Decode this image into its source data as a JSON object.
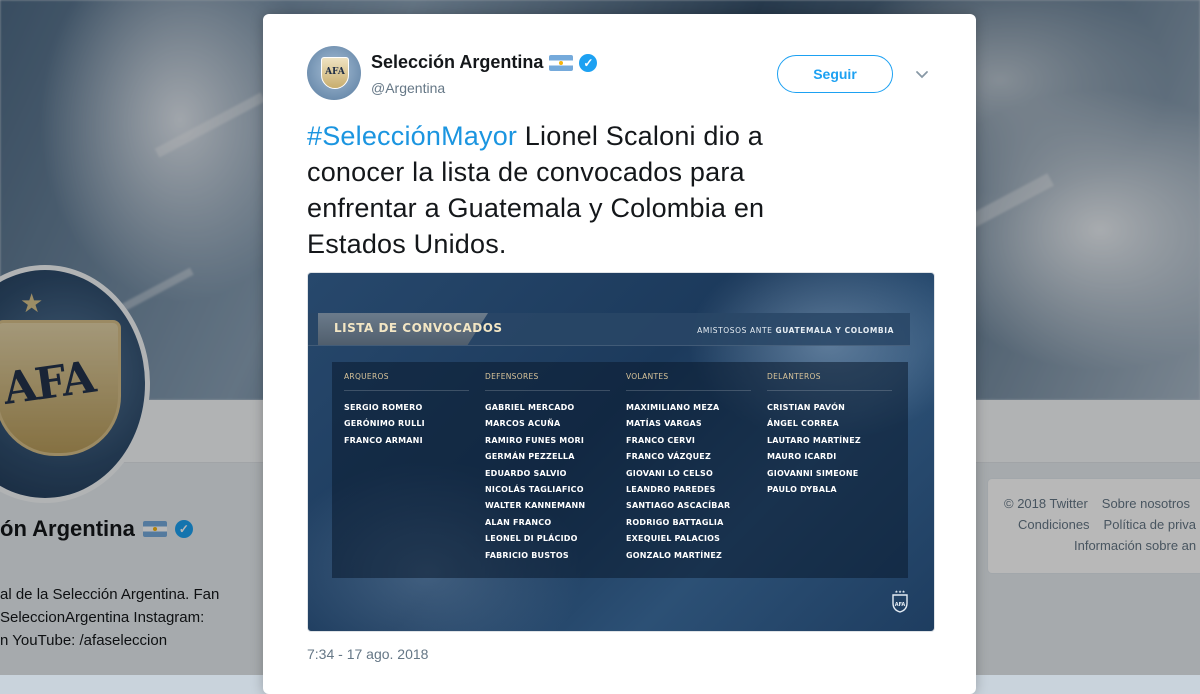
{
  "profile": {
    "name": "ón Argentina",
    "bio_lines": [
      "al de la Selección Argentina. Fan",
      "SeleccionArgentina Instagram:",
      "n YouTube: /afaseleccion"
    ],
    "footer_row1": [
      "© 2018 Twitter",
      "Sobre nosotros"
    ],
    "footer_row2": [
      "Condiciones",
      "Política de priva"
    ],
    "footer_row3": [
      "Información sobre an"
    ]
  },
  "tweet": {
    "author_name": "Selección Argentina",
    "author_handle": "@Argentina",
    "follow_label": "Seguir",
    "hashtag": "#SelecciónMayor",
    "text": " Lionel Scaloni dio a conocer la lista de convocados para enfrentar a Guatemala y Colombia en Estados Unidos.",
    "timestamp": "7:34 - 17 ago. 2018"
  },
  "media": {
    "title": "LISTA DE CONVOCADOS",
    "subtitle_prefix": "AMISTOSOS ANTE ",
    "subtitle_bold": "GUATEMALA Y COLOMBIA",
    "columns": [
      {
        "heading": "ARQUEROS",
        "players": [
          "SERGIO ROMERO",
          "GERÓNIMO RULLI",
          "FRANCO ARMANI"
        ]
      },
      {
        "heading": "DEFENSORES",
        "players": [
          "GABRIEL MERCADO",
          "MARCOS ACUÑA",
          "RAMIRO FUNES MORI",
          "GERMÁN PEZZELLA",
          "EDUARDO SALVIO",
          "NICOLÁS TAGLIAFICO",
          "WALTER KANNEMANN",
          "ALAN FRANCO",
          "LEONEL DI PLÁCIDO",
          "FABRICIO BUSTOS"
        ]
      },
      {
        "heading": "VOLANTES",
        "players": [
          "MAXIMILIANO MEZA",
          "MATÍAS VARGAS",
          "FRANCO CERVI",
          "FRANCO VÁZQUEZ",
          "GIOVANI LO CELSO",
          "LEANDRO PAREDES",
          "SANTIAGO ASCACÍBAR",
          "RODRIGO BATTAGLIA",
          "EXEQUIEL PALACIOS",
          "GONZALO MARTÍNEZ"
        ]
      },
      {
        "heading": "DELANTEROS",
        "players": [
          "CRISTIAN PAVÓN",
          "ÁNGEL CORREA",
          "LAUTARO MARTÍNEZ",
          "MAURO ICARDI",
          "GIOVANNI SIMEONE",
          "PAULO DYBALA"
        ]
      }
    ]
  },
  "icons": {
    "verified": "verified-badge-icon",
    "flag": "argentina-flag-icon",
    "chevron": "chevron-down-icon"
  },
  "colors": {
    "twitter_blue": "#1da1f2",
    "hashtag_blue": "#1b95e0",
    "text": "#14171a",
    "muted": "#657786"
  }
}
